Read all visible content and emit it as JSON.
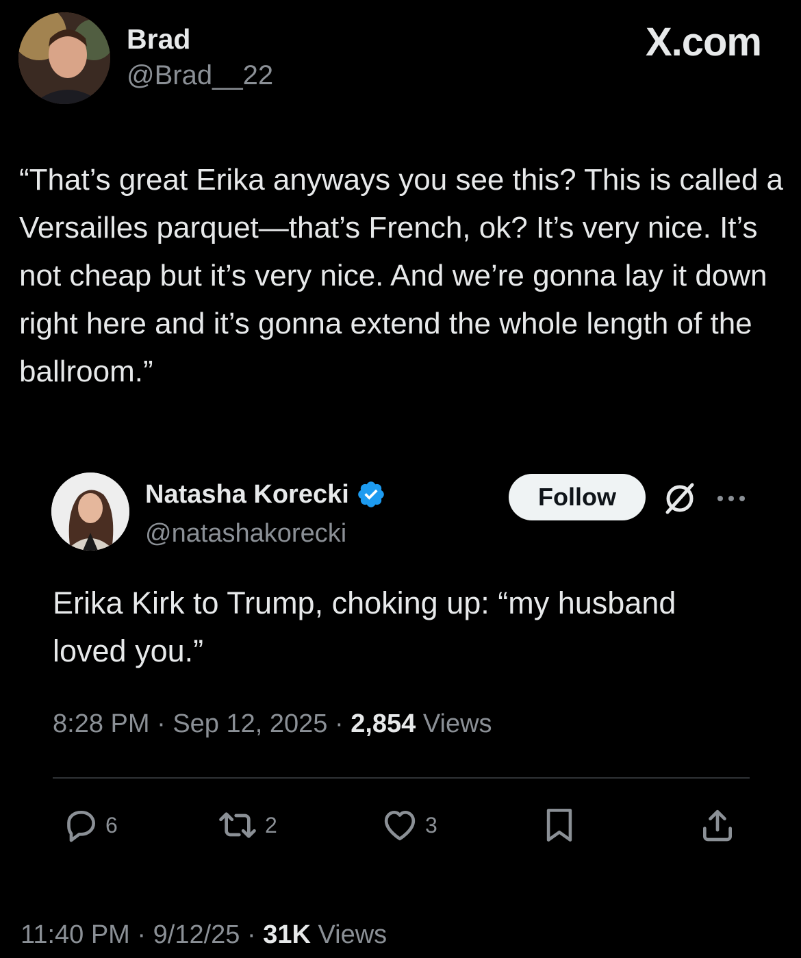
{
  "outer_tweet": {
    "author_name": "Brad",
    "author_handle": "@Brad__22",
    "site_label": "X.com",
    "text": "“That’s great Erika anyways you see this? This is called a Versailles parquet—that’s French, ok? It’s very nice. It’s not cheap but it’s very nice. And we’re gonna lay it down right here and it’s gonna extend the whole length of the ballroom.”",
    "time": "11:40 PM",
    "date": "9/12/25",
    "views_count": "31K",
    "views_label": "Views"
  },
  "inner_tweet": {
    "author_name": "Natasha Korecki",
    "author_handle": "@natashakorecki",
    "follow_label": "Follow",
    "text": "Erika Kirk to Trump, choking up: “my husband loved you.”",
    "time": "8:28 PM",
    "date": "Sep 12, 2025",
    "views_count": "2,854",
    "views_label": "Views",
    "actions": {
      "reply_count": "6",
      "repost_count": "2",
      "like_count": "3"
    }
  },
  "separator": "·",
  "colors": {
    "background": "#000000",
    "primary_text": "#e7e9ea",
    "secondary_text": "#8b9096",
    "verified_badge": "#1d9bf0",
    "follow_button_bg": "#eff3f4",
    "divider": "#2f3336"
  },
  "icons": [
    "verified-badge-icon",
    "grok-icon",
    "more-icon",
    "reply-icon",
    "repost-icon",
    "like-icon",
    "bookmark-icon",
    "share-icon"
  ]
}
